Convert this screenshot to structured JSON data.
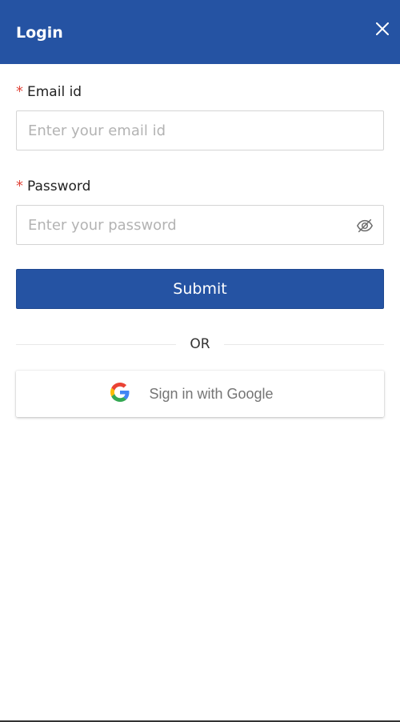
{
  "header": {
    "title": "Login",
    "background_color": "#2553a3",
    "close_icon": "close-icon"
  },
  "form": {
    "email": {
      "required_mark": "*",
      "label": "Email id",
      "placeholder": "Enter your email id",
      "value": ""
    },
    "password": {
      "required_mark": "*",
      "label": "Password",
      "placeholder": "Enter your password",
      "value": "",
      "toggle_icon": "eye-off-icon"
    },
    "submit_label": "Submit"
  },
  "divider": {
    "text": "OR"
  },
  "google": {
    "label": "Sign in with Google",
    "icon": "google-logo-icon"
  },
  "colors": {
    "primary": "#2553a3",
    "required": "#e0453a"
  }
}
